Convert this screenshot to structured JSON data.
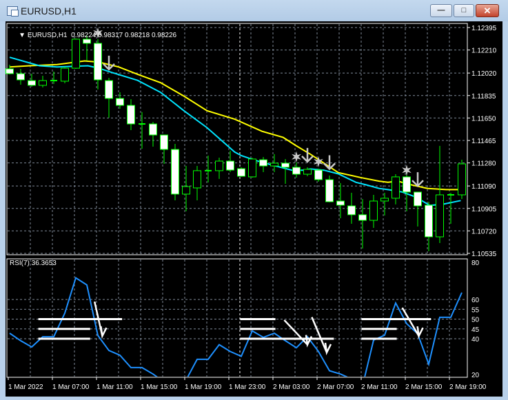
{
  "window": {
    "title": "EURUSD,H1",
    "min": "—",
    "max": "□",
    "close": "✕"
  },
  "header": {
    "symbol": "EURUSD,H1",
    "ohlc": "0.98224 0.98317 0.98218 0.98226"
  },
  "rsi_label": "RSI(7) 36.3653",
  "colors": {
    "bull": "#00ff00",
    "bear_body": "#ffffff",
    "ma_slow": "#ffff00",
    "ma_fast": "#00e5ff",
    "rsi": "#1e90ff",
    "grid": "#7f8a99",
    "signal": "#c8c8c8"
  },
  "chart_data": {
    "type": "candlestick",
    "price_axis": [
      "1.12395",
      "1.12210",
      "1.12020",
      "1.11835",
      "1.11650",
      "1.11465",
      "1.11280",
      "1.11090",
      "1.10905",
      "1.10720",
      "1.10535"
    ],
    "price_range": [
      1.10535,
      1.12395
    ],
    "rsi_axis": [
      "80",
      "60",
      "55",
      "50",
      "45",
      "40",
      "20"
    ],
    "rsi_range": [
      20,
      80
    ],
    "time_labels": [
      "1 Mar 2022",
      "1 Mar 07:00",
      "1 Mar 11:00",
      "1 Mar 15:00",
      "1 Mar 19:00",
      "1 Mar 23:00",
      "2 Mar 03:00",
      "2 Mar 07:00",
      "2 Mar 11:00",
      "2 Mar 15:00",
      "2 Mar 19:00"
    ],
    "candles": [
      [
        1.12055,
        1.12089,
        1.12009,
        1.12015
      ],
      [
        1.12015,
        1.12055,
        1.11924,
        1.11964
      ],
      [
        1.11958,
        1.12015,
        1.11907,
        1.11919
      ],
      [
        1.11919,
        1.11998,
        1.11902,
        1.11958
      ],
      [
        1.11958,
        1.12032,
        1.1193,
        1.11958
      ],
      [
        1.11953,
        1.12072,
        1.11936,
        1.1206
      ],
      [
        1.1206,
        1.12305,
        1.12055,
        1.12299
      ],
      [
        1.12299,
        1.12327,
        1.12123,
        1.12265
      ],
      [
        1.12265,
        1.12299,
        1.11885,
        1.11964
      ],
      [
        1.11958,
        1.11981,
        1.11652,
        1.11811
      ],
      [
        1.11811,
        1.11862,
        1.11726,
        1.11754
      ],
      [
        1.11754,
        1.11805,
        1.1155,
        1.11601
      ],
      [
        1.11601,
        1.11698,
        1.11397,
        1.11601
      ],
      [
        1.11601,
        1.11618,
        1.11414,
        1.1151
      ],
      [
        1.1151,
        1.1151,
        1.11272,
        1.11391
      ],
      [
        1.11391,
        1.11437,
        1.10972,
        1.11023
      ],
      [
        1.11023,
        1.11255,
        1.10881,
        1.11085
      ],
      [
        1.11074,
        1.11255,
        1.10972,
        1.11216
      ],
      [
        1.11216,
        1.1134,
        1.11119,
        1.11216
      ],
      [
        1.11216,
        1.11323,
        1.11148,
        1.11295
      ],
      [
        1.11295,
        1.1138,
        1.11204,
        1.11221
      ],
      [
        1.11233,
        1.11244,
        1.11165,
        1.1117
      ],
      [
        1.11165,
        1.11323,
        1.11159,
        1.11312
      ],
      [
        1.11306,
        1.11329,
        1.11204,
        1.11255
      ],
      [
        1.11255,
        1.11352,
        1.11204,
        1.11278
      ],
      [
        1.11278,
        1.11312,
        1.11108,
        1.11244
      ],
      [
        1.11244,
        1.11284,
        1.11159,
        1.11187
      ],
      [
        1.11187,
        1.11244,
        1.1117,
        1.11227
      ],
      [
        1.11221,
        1.11233,
        1.11125,
        1.11142
      ],
      [
        1.11142,
        1.11176,
        1.10955,
        1.1096
      ],
      [
        1.10966,
        1.11114,
        1.10824,
        1.10932
      ],
      [
        1.10926,
        1.11034,
        1.10779,
        1.10853
      ],
      [
        1.10853,
        1.10983,
        1.10575,
        1.10807
      ],
      [
        1.10807,
        1.11017,
        1.10745,
        1.10966
      ],
      [
        1.10966,
        1.11034,
        1.10847,
        1.10989
      ],
      [
        1.10989,
        1.11187,
        1.10938,
        1.11165
      ],
      [
        1.11165,
        1.11187,
        1.10881,
        1.1104
      ],
      [
        1.1104,
        1.1104,
        1.10756,
        1.10926
      ],
      [
        1.10932,
        1.1096,
        1.10552,
        1.10671
      ],
      [
        1.10671,
        1.1142,
        1.1062,
        1.11017
      ],
      [
        1.11017,
        1.11034,
        1.10779,
        1.11017
      ],
      [
        1.11017,
        1.11306,
        1.10983,
        1.11272
      ]
    ],
    "ma_slow": [
      [
        0,
        1.1207
      ],
      [
        1.8,
        1.1208
      ],
      [
        4.3,
        1.1209
      ],
      [
        6.8,
        1.1212
      ],
      [
        8.1,
        1.1211
      ],
      [
        9.9,
        1.1207
      ],
      [
        11.6,
        1.1201
      ],
      [
        13.7,
        1.1194
      ],
      [
        15.8,
        1.1183
      ],
      [
        17.9,
        1.1171
      ],
      [
        20.4,
        1.1164
      ],
      [
        22.9,
        1.1154
      ],
      [
        24.8,
        1.1149
      ],
      [
        26,
        1.1142
      ],
      [
        27.3,
        1.1135
      ],
      [
        29.8,
        1.112
      ],
      [
        31.8,
        1.1116
      ],
      [
        33.5,
        1.1113
      ],
      [
        34.3,
        1.1112
      ],
      [
        35.2,
        1.1113
      ],
      [
        36.4,
        1.111
      ],
      [
        37.9,
        1.1107
      ],
      [
        39.6,
        1.1106
      ],
      [
        40.9,
        1.1106
      ]
    ],
    "ma_fast": [
      [
        0,
        1.1215
      ],
      [
        2.7,
        1.1208
      ],
      [
        4.3,
        1.1207
      ],
      [
        7.1,
        1.1208
      ],
      [
        8.1,
        1.1206
      ],
      [
        9.1,
        1.1203
      ],
      [
        11.6,
        1.1196
      ],
      [
        13.7,
        1.1186
      ],
      [
        15.8,
        1.1171
      ],
      [
        17.9,
        1.1157
      ],
      [
        20.4,
        1.1137
      ],
      [
        21,
        1.1134
      ],
      [
        22.3,
        1.113
      ],
      [
        23.9,
        1.1126
      ],
      [
        25.6,
        1.1122
      ],
      [
        26.6,
        1.1122
      ],
      [
        27.3,
        1.1123
      ],
      [
        28.5,
        1.1122
      ],
      [
        29.8,
        1.1119
      ],
      [
        31.4,
        1.1112
      ],
      [
        32.3,
        1.111
      ],
      [
        33.5,
        1.1107
      ],
      [
        34.3,
        1.1106
      ],
      [
        35.6,
        1.1104
      ],
      [
        36.8,
        1.11
      ],
      [
        38.1,
        1.1093
      ],
      [
        39.3,
        1.1094
      ],
      [
        40.9,
        1.1097
      ]
    ],
    "signals": [
      {
        "type": "star",
        "bar": 8,
        "price": 1.1235
      },
      {
        "type": "arrow-down",
        "bar": 9,
        "price": 1.1205
      },
      {
        "type": "star",
        "bar": 26,
        "price": 1.1133
      },
      {
        "type": "arrow-down",
        "bar": 27,
        "price": 1.1129
      },
      {
        "type": "star",
        "bar": 28,
        "price": 1.1129
      },
      {
        "type": "arrow-down",
        "bar": 29,
        "price": 1.1123
      },
      {
        "type": "star",
        "bar": 36,
        "price": 1.1122
      },
      {
        "type": "arrow-down",
        "bar": 37,
        "price": 1.1109
      }
    ],
    "rsi": [
      42.8,
      39,
      35.8,
      41,
      41,
      53,
      71,
      67.4,
      41.7,
      34,
      31.6,
      25.3,
      25.3,
      22,
      18,
      15,
      19,
      29.5,
      29.5,
      37,
      33.5,
      31,
      44,
      40.7,
      42.8,
      39,
      35.4,
      41,
      33.5,
      23.7,
      22,
      19.5,
      16,
      39.3,
      41.8,
      58.2,
      47.7,
      42.5,
      27,
      50.9,
      50.9,
      63.5
    ],
    "rsi_levels": [
      {
        "value": 50,
        "from": 2.6,
        "to": 10.2
      },
      {
        "value": 45,
        "from": 2.6,
        "to": 7.3
      },
      {
        "value": 40,
        "from": 2.6,
        "to": 7.3
      },
      {
        "value": 50,
        "from": 20.9,
        "to": 24.1
      },
      {
        "value": 45,
        "from": 20.9,
        "to": 24.1
      },
      {
        "value": 40,
        "from": 20.9,
        "to": 29.4
      },
      {
        "value": 50,
        "from": 31.9,
        "to": 38.2
      },
      {
        "value": 45,
        "from": 31.9,
        "to": 35.1
      },
      {
        "value": 40,
        "from": 31.9,
        "to": 35.1
      }
    ],
    "rsi_arrows": [
      {
        "from": [
          7.7,
          58.9
        ],
        "to": [
          8.4,
          41.4
        ]
      },
      {
        "from": [
          24.9,
          49.5
        ],
        "to": [
          27,
          37
        ]
      },
      {
        "from": [
          27.4,
          51
        ],
        "to": [
          28.75,
          33
        ]
      },
      {
        "from": [
          35.6,
          55.8
        ],
        "to": [
          37.1,
          41.4
        ]
      }
    ]
  }
}
